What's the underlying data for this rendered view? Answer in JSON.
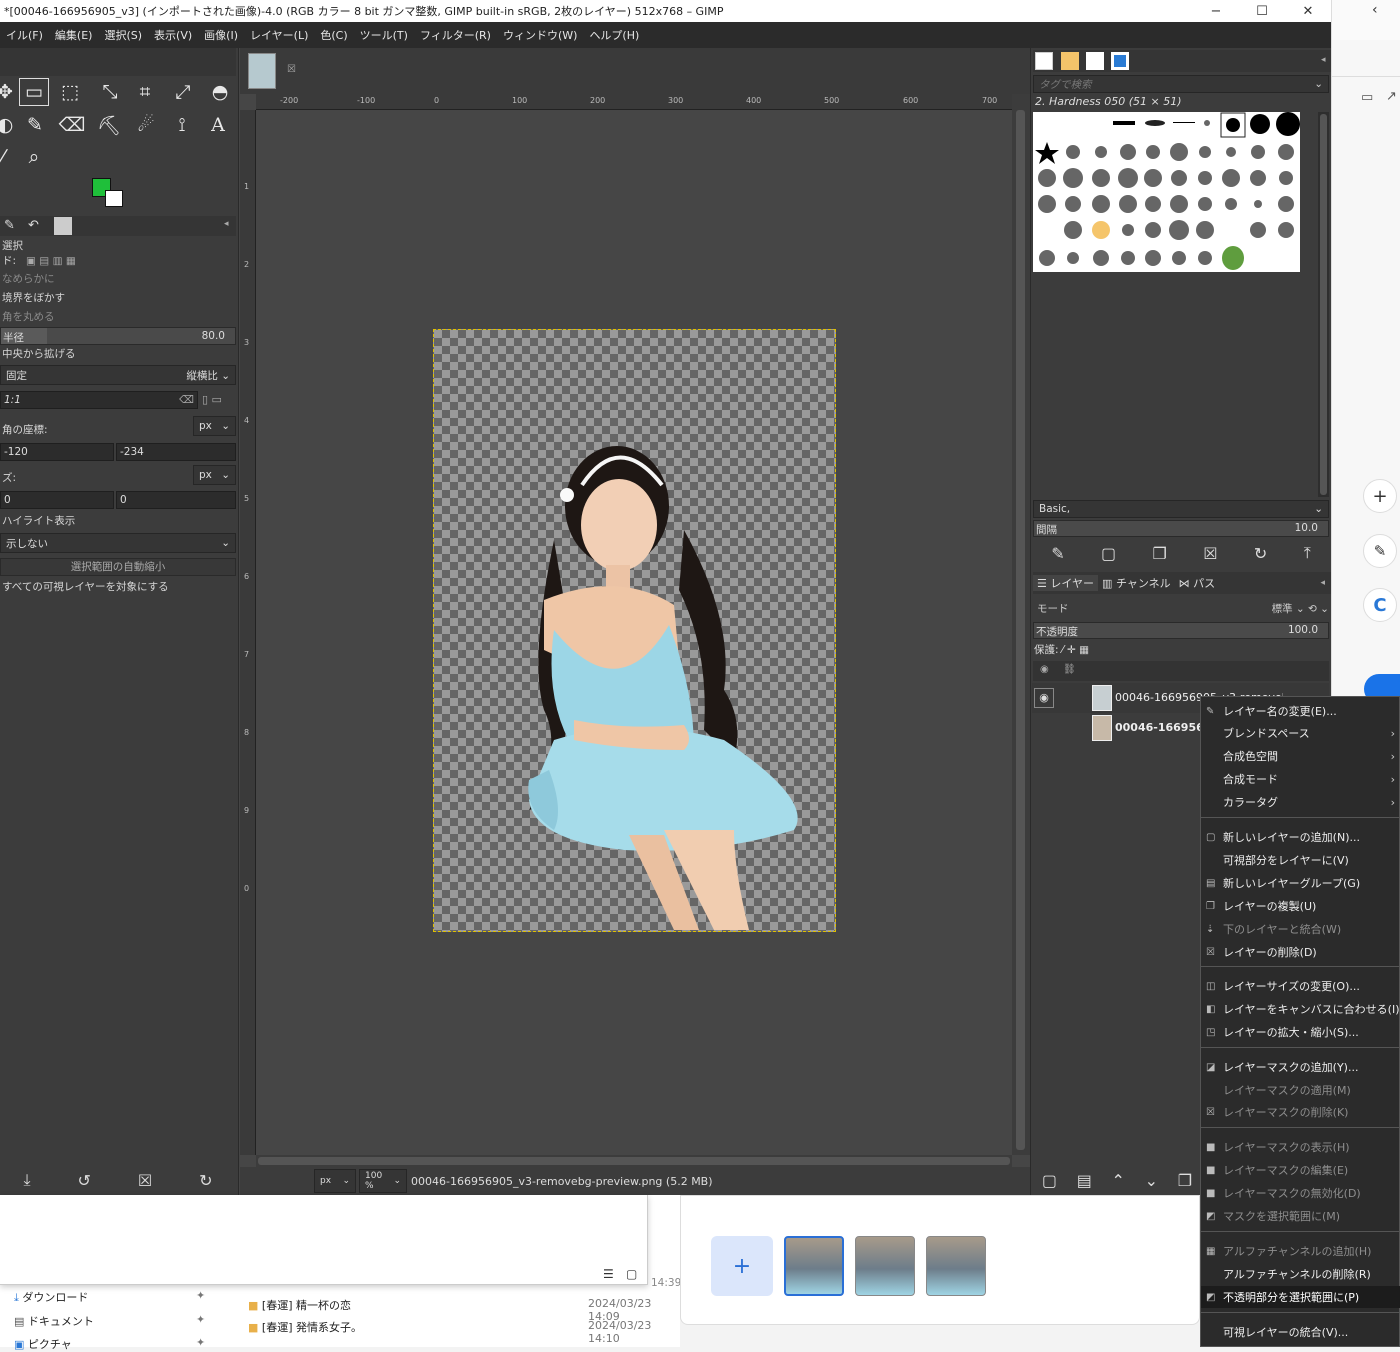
{
  "window": {
    "title": "*[00046-166956905_v3] (インポートされた画像)-4.0 (RGB カラー 8 bit ガンマ整数, GIMP built-in sRGB, 2枚のレイヤー) 512x768 – GIMP",
    "minimize": "−",
    "maximize": "☐",
    "close": "✕"
  },
  "menubar": [
    "イル(F)",
    "編集(E)",
    "選択(S)",
    "表示(V)",
    "画像(I)",
    "レイヤー(L)",
    "色(C)",
    "ツール(T)",
    "フィルター(R)",
    "ウィンドウ(W)",
    "ヘルプ(H)"
  ],
  "tool_options": {
    "title": "選択",
    "mode_label": "ド:",
    "antialias": "なめらかに",
    "feather": "境界をぼかす",
    "round_corners": "角を丸める",
    "radius_label": "半径",
    "radius_value": "80.0",
    "expand_center": "中央から拡げる",
    "fixed_label": "固定",
    "fixed_value": "縦横比",
    "ratio_value": "1:1",
    "position_label": "角の座標:",
    "position_unit": "px",
    "pos_x": "-120",
    "pos_y": "-234",
    "size_label": "ズ:",
    "size_unit": "px",
    "size_w": "0",
    "size_h": "0",
    "highlight_label": "ハイライト表示",
    "highlight_value": "示しない",
    "auto_shrink": "選択範囲の自動縮小",
    "all_visible": "すべての可視レイヤーを対象にする"
  },
  "ruler_h": [
    "-200",
    "-100",
    "0",
    "100",
    "200",
    "300",
    "400",
    "500",
    "600",
    "700"
  ],
  "ruler_v": [
    "1",
    "2",
    "3",
    "4",
    "5",
    "6",
    "7",
    "8",
    "9",
    "0"
  ],
  "statusbar": {
    "unit": "px",
    "zoom": "100 %",
    "file": "00046-166956905_v3-removebg-preview.png (5.2 MB)"
  },
  "brushes": {
    "search_placeholder": "タグで検索",
    "current_brush": "2. Hardness 050 (51 × 51)",
    "preset": "Basic,",
    "spacing_label": "間隔",
    "spacing_value": "10.0"
  },
  "layers": {
    "tabs": [
      "レイヤー",
      "チャンネル",
      "パス"
    ],
    "mode_label": "モード",
    "mode_value": "標準",
    "opacity_label": "不透明度",
    "opacity_value": "100.0",
    "lock_label": "保護:",
    "items": [
      {
        "name": "00046-166956905_v3-removebg-preview"
      },
      {
        "name": "00046-1669569"
      }
    ]
  },
  "context_menu": {
    "items": [
      {
        "label": "レイヤー名の変更(E)...",
        "icon": "✎"
      },
      {
        "label": "ブレンドスペース",
        "submenu": true
      },
      {
        "label": "合成色空間",
        "submenu": true
      },
      {
        "label": "合成モード",
        "submenu": true
      },
      {
        "label": "カラータグ",
        "submenu": true
      },
      {
        "sep": true
      },
      {
        "label": "新しいレイヤーの追加(N)...",
        "icon": "▢"
      },
      {
        "label": "可視部分をレイヤーに(V)"
      },
      {
        "label": "新しいレイヤーグループ(G)",
        "icon": "▤"
      },
      {
        "label": "レイヤーの複製(U)",
        "icon": "❐"
      },
      {
        "label": "下のレイヤーと統合(W)",
        "icon": "⇣",
        "disabled": true
      },
      {
        "label": "レイヤーの削除(D)",
        "icon": "☒"
      },
      {
        "sep": true
      },
      {
        "label": "レイヤーサイズの変更(O)...",
        "icon": "◫"
      },
      {
        "label": "レイヤーをキャンバスに合わせる(I)",
        "icon": "◧"
      },
      {
        "label": "レイヤーの拡大・縮小(S)...",
        "icon": "◳"
      },
      {
        "sep": true
      },
      {
        "label": "レイヤーマスクの追加(Y)...",
        "icon": "◪"
      },
      {
        "label": "レイヤーマスクの適用(M)",
        "disabled": true
      },
      {
        "label": "レイヤーマスクの削除(K)",
        "icon": "☒",
        "disabled": true
      },
      {
        "sep": true
      },
      {
        "label": "レイヤーマスクの表示(H)",
        "icon": "■",
        "disabled": true
      },
      {
        "label": "レイヤーマスクの編集(E)",
        "icon": "■",
        "disabled": true
      },
      {
        "label": "レイヤーマスクの無効化(D)",
        "icon": "■",
        "disabled": true
      },
      {
        "label": "マスクを選択範囲に(M)",
        "icon": "◩",
        "disabled": true
      },
      {
        "sep": true
      },
      {
        "label": "アルファチャンネルの追加(H)",
        "icon": "▦",
        "disabled": true
      },
      {
        "label": "アルファチャンネルの削除(R)"
      },
      {
        "label": "不透明部分を選択範囲に(P)",
        "icon": "◩",
        "highlighted": true
      },
      {
        "sep": true
      },
      {
        "label": "可視レイヤーの統合(V)..."
      }
    ]
  },
  "explorer": {
    "quick_access": [
      {
        "name": "ダウンロード"
      },
      {
        "name": "ドキュメント"
      },
      {
        "name": "ピクチャ"
      }
    ],
    "files": [
      {
        "name": "[春運] 精一杯の恋",
        "date": "2024/03/23 14:09"
      },
      {
        "name": "[春運] 発情系女子。",
        "date": "2024/03/23 14:10"
      }
    ],
    "time_partial": "14:39"
  },
  "photostrip": {
    "add_label": "+"
  },
  "colors": {
    "fg": "#1fbf3a",
    "bg": "#ffffff",
    "menu_bg": "#2b2b2b",
    "gimp_bg": "#454545"
  }
}
